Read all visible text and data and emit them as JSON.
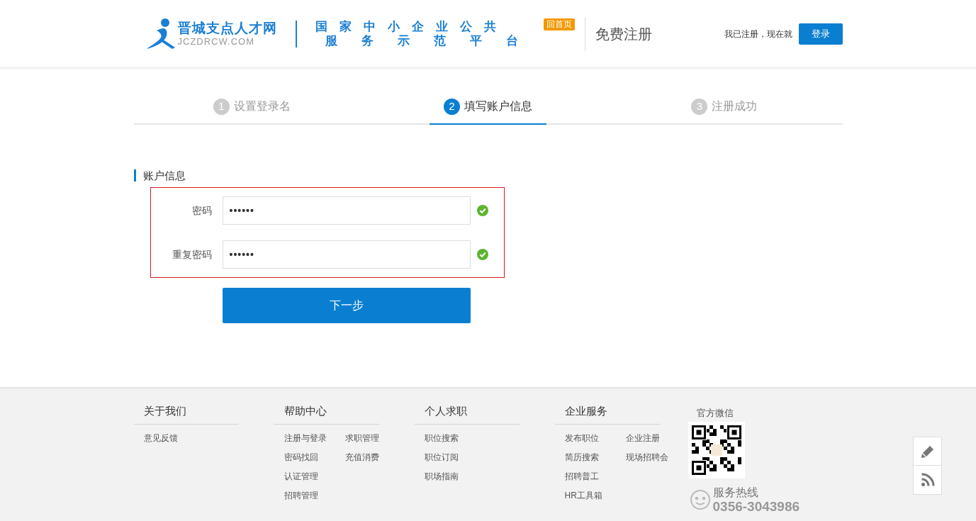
{
  "header": {
    "logo": {
      "name": "晋城支点人才网",
      "domain": "JCZDRCW.COM"
    },
    "slogan": [
      "国家中小企业公共",
      "服务示范平台"
    ],
    "home_badge": "回首页",
    "page_title": "免费注册",
    "login_prompt": "我已注册，现在就",
    "login_button": "登录"
  },
  "steps": [
    {
      "number": "1",
      "label": "设置登录名",
      "selected": false
    },
    {
      "number": "2",
      "label": "填写账户信息",
      "selected": true
    },
    {
      "number": "3",
      "label": "注册成功",
      "selected": false
    }
  ],
  "form": {
    "section_title": "账户信息",
    "fields": [
      {
        "label": "密码",
        "value": "••••••",
        "valid": true
      },
      {
        "label": "重复密码",
        "value": "••••••",
        "valid": true
      }
    ],
    "submit": "下一步"
  },
  "footer": {
    "columns": [
      {
        "title": "关于我们",
        "rows": [
          [
            "意见反馈"
          ]
        ]
      },
      {
        "title": "帮助中心",
        "rows": [
          [
            "注册与登录",
            "求职管理"
          ],
          [
            "密码找回",
            "充值消费"
          ],
          [
            "认证管理"
          ],
          [
            "招聘管理"
          ]
        ]
      },
      {
        "title": "个人求职",
        "rows": [
          [
            "职位搜索"
          ],
          [
            "职位订阅"
          ],
          [
            "职场指南"
          ]
        ]
      },
      {
        "title": "企业服务",
        "rows": [
          [
            "发布职位",
            "企业注册"
          ],
          [
            "简历搜索",
            "现场招聘会"
          ],
          [
            "招聘普工"
          ],
          [
            "HR工具箱"
          ]
        ]
      }
    ],
    "wechat_title": "官方微信",
    "hotline_label": "服务热线",
    "hotline_number": "0356-3043986"
  }
}
